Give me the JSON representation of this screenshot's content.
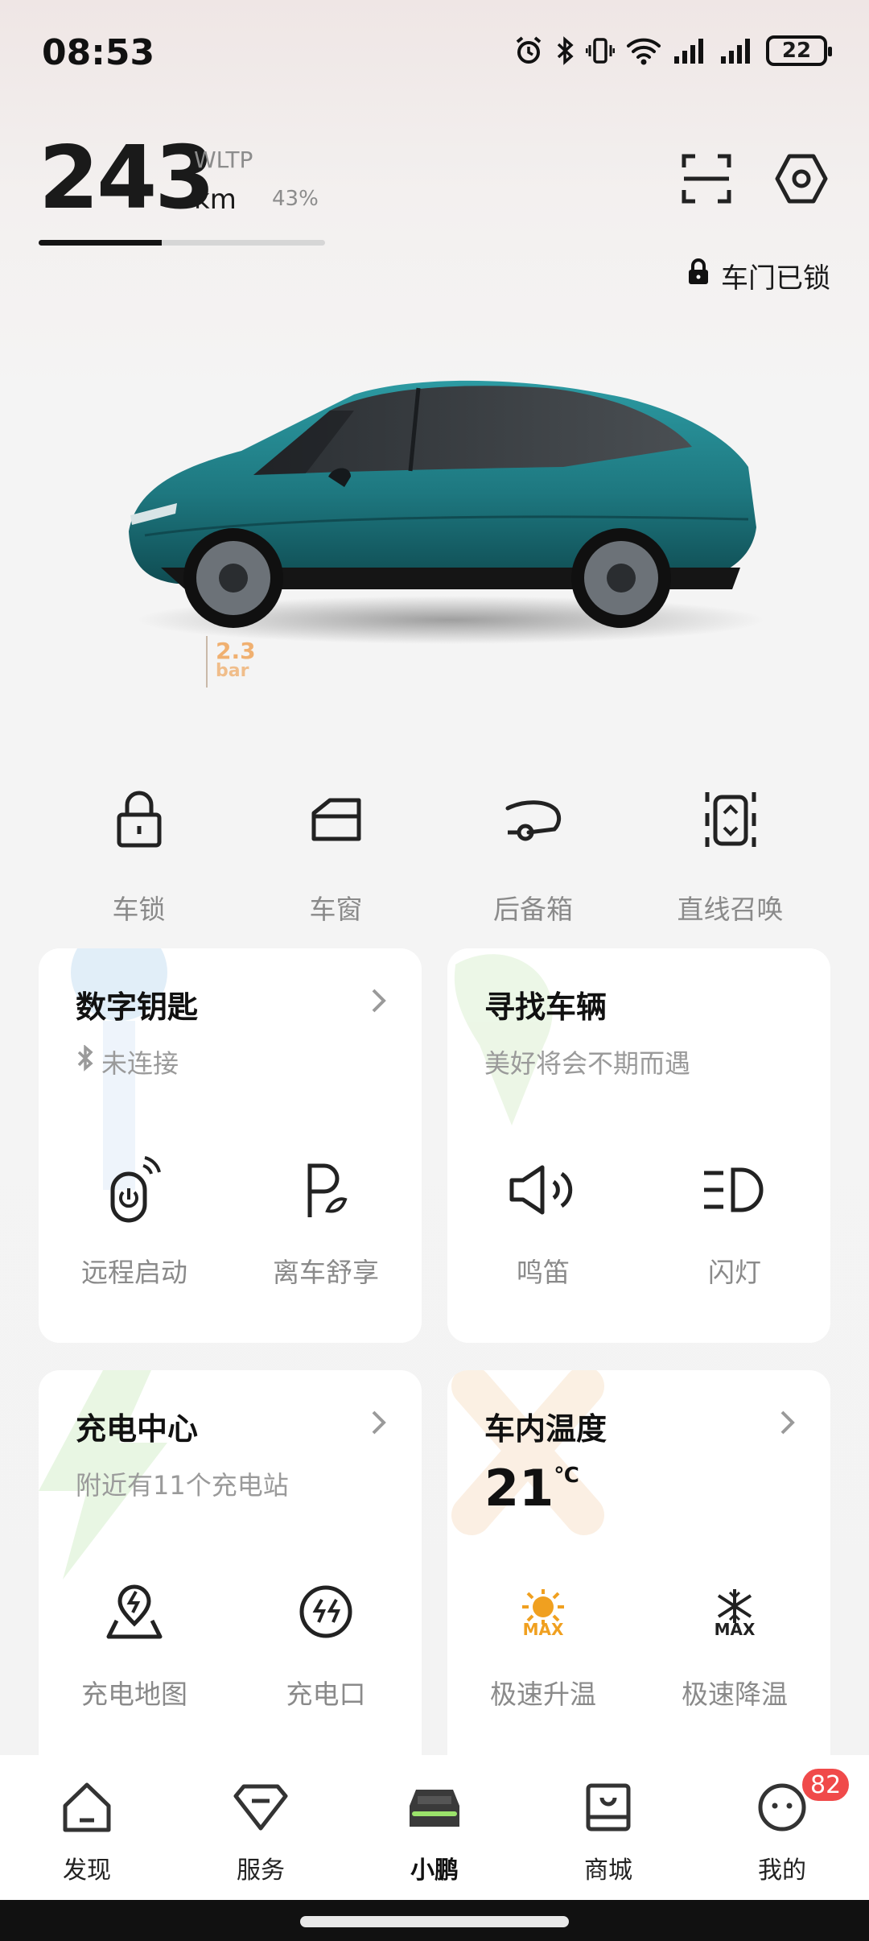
{
  "status_bar": {
    "time": "08:53",
    "battery": "22"
  },
  "range": {
    "value": "243",
    "standard": "WLTP",
    "unit": "km",
    "percent": "43%",
    "level": 0.43
  },
  "vehicle": {
    "lock_status": "车门已锁",
    "tire_pressure_value": "2.3",
    "tire_pressure_unit": "bar",
    "color": "#1f7b82"
  },
  "quick_actions": [
    {
      "label": "车锁",
      "icon": "lock-icon"
    },
    {
      "label": "车窗",
      "icon": "window-icon"
    },
    {
      "label": "后备箱",
      "icon": "trunk-icon"
    },
    {
      "label": "直线召唤",
      "icon": "summon-icon"
    }
  ],
  "cards": {
    "digital_key": {
      "title": "数字钥匙",
      "status": "未连接",
      "actions": [
        {
          "label": "远程启动",
          "icon": "remote-start-icon"
        },
        {
          "label": "离车舒享",
          "icon": "parking-comfort-icon"
        }
      ]
    },
    "find_vehicle": {
      "title": "寻找车辆",
      "subtitle": "美好将会不期而遇",
      "actions": [
        {
          "label": "鸣笛",
          "icon": "horn-icon"
        },
        {
          "label": "闪灯",
          "icon": "headlight-icon"
        }
      ]
    },
    "charging": {
      "title": "充电中心",
      "subtitle": "附近有11个充电站",
      "actions": [
        {
          "label": "充电地图",
          "icon": "charging-map-icon"
        },
        {
          "label": "充电口",
          "icon": "charging-port-icon"
        }
      ]
    },
    "climate": {
      "title": "车内温度",
      "temperature": "21",
      "temperature_unit": "℃",
      "actions": [
        {
          "label": "极速升温",
          "icon": "max-heat-icon",
          "icon_text": "MAX"
        },
        {
          "label": "极速降温",
          "icon": "max-cool-icon",
          "icon_text": "MAX"
        }
      ]
    }
  },
  "bottom_nav": [
    {
      "label": "发现",
      "icon": "discover-icon"
    },
    {
      "label": "服务",
      "icon": "service-icon"
    },
    {
      "label": "小鹏",
      "icon": "car-icon",
      "active": true
    },
    {
      "label": "商城",
      "icon": "store-icon"
    },
    {
      "label": "我的",
      "icon": "profile-icon",
      "badge": "82"
    }
  ],
  "colors": {
    "accent_orange": "#f0a020",
    "badge_red": "#f04a4a",
    "active_green": "#9be36b"
  }
}
